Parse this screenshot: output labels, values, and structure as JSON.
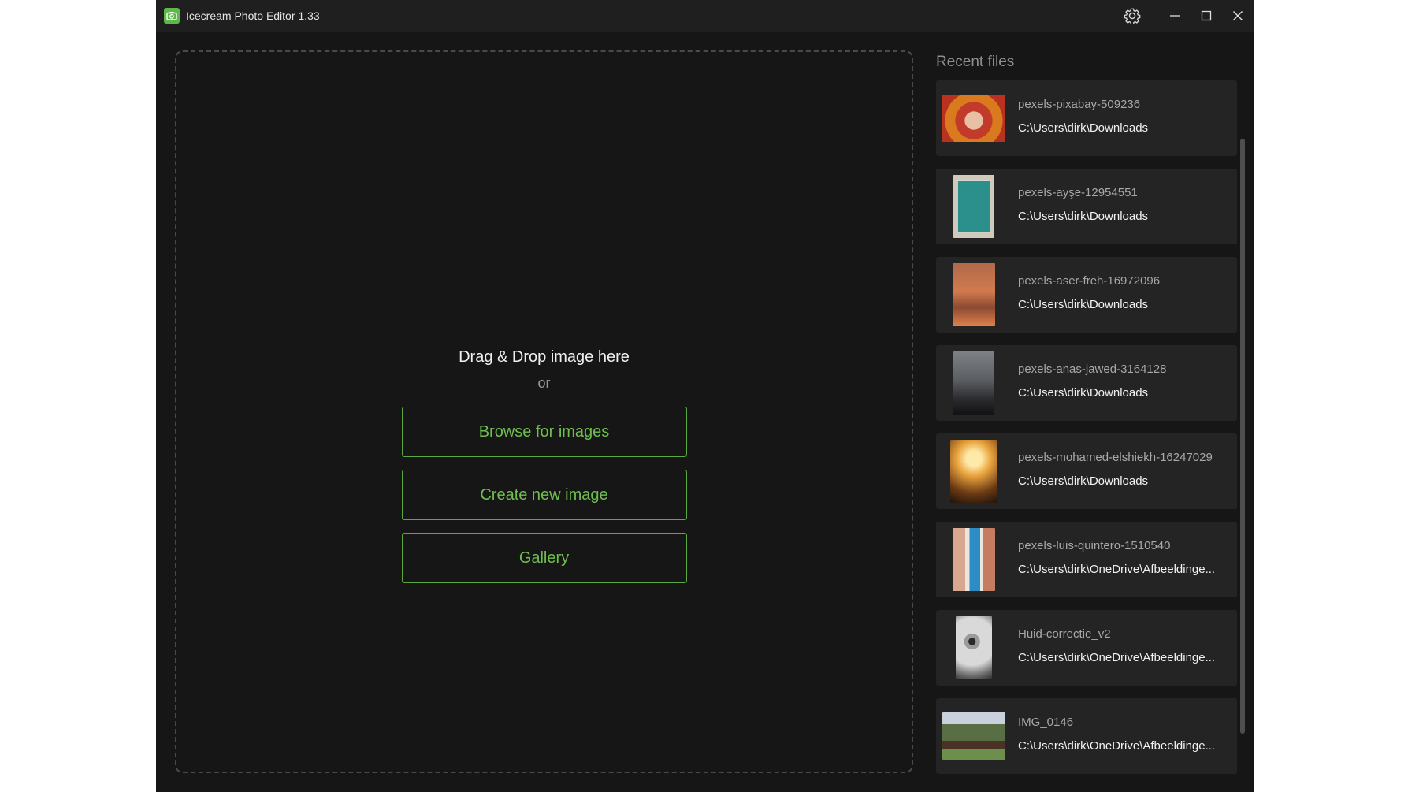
{
  "window": {
    "title": "Icecream Photo Editor 1.33"
  },
  "titlebar": {
    "settings_icon": "gear-icon",
    "minimize_icon": "minimize-icon",
    "maximize_icon": "maximize-icon",
    "close_icon": "close-icon"
  },
  "dropzone": {
    "heading": "Drag & Drop image here",
    "or": "or",
    "browse_label": "Browse for images",
    "create_label": "Create new image",
    "gallery_label": "Gallery"
  },
  "recent": {
    "title": "Recent files",
    "items": [
      {
        "name": "pexels-pixabay-509236",
        "path": "C:\\Users\\dirk\\Downloads"
      },
      {
        "name": "pexels-ayşe-12954551",
        "path": "C:\\Users\\dirk\\Downloads"
      },
      {
        "name": "pexels-aser-freh-16972096",
        "path": "C:\\Users\\dirk\\Downloads"
      },
      {
        "name": "pexels-anas-jawed-3164128",
        "path": "C:\\Users\\dirk\\Downloads"
      },
      {
        "name": "pexels-mohamed-elshiekh-16247029",
        "path": "C:\\Users\\dirk\\Downloads"
      },
      {
        "name": "pexels-luis-quintero-1510540",
        "path": "C:\\Users\\dirk\\OneDrive\\Afbeeldinge..."
      },
      {
        "name": "Huid-correctie_v2",
        "path": "C:\\Users\\dirk\\OneDrive\\Afbeeldinge..."
      },
      {
        "name": "IMG_0146",
        "path": "C:\\Users\\dirk\\OneDrive\\Afbeeldinge..."
      }
    ]
  },
  "colors": {
    "accent": "#5fb84a",
    "background": "#161616",
    "titlebar": "#1f1f1f",
    "card": "#242424"
  }
}
